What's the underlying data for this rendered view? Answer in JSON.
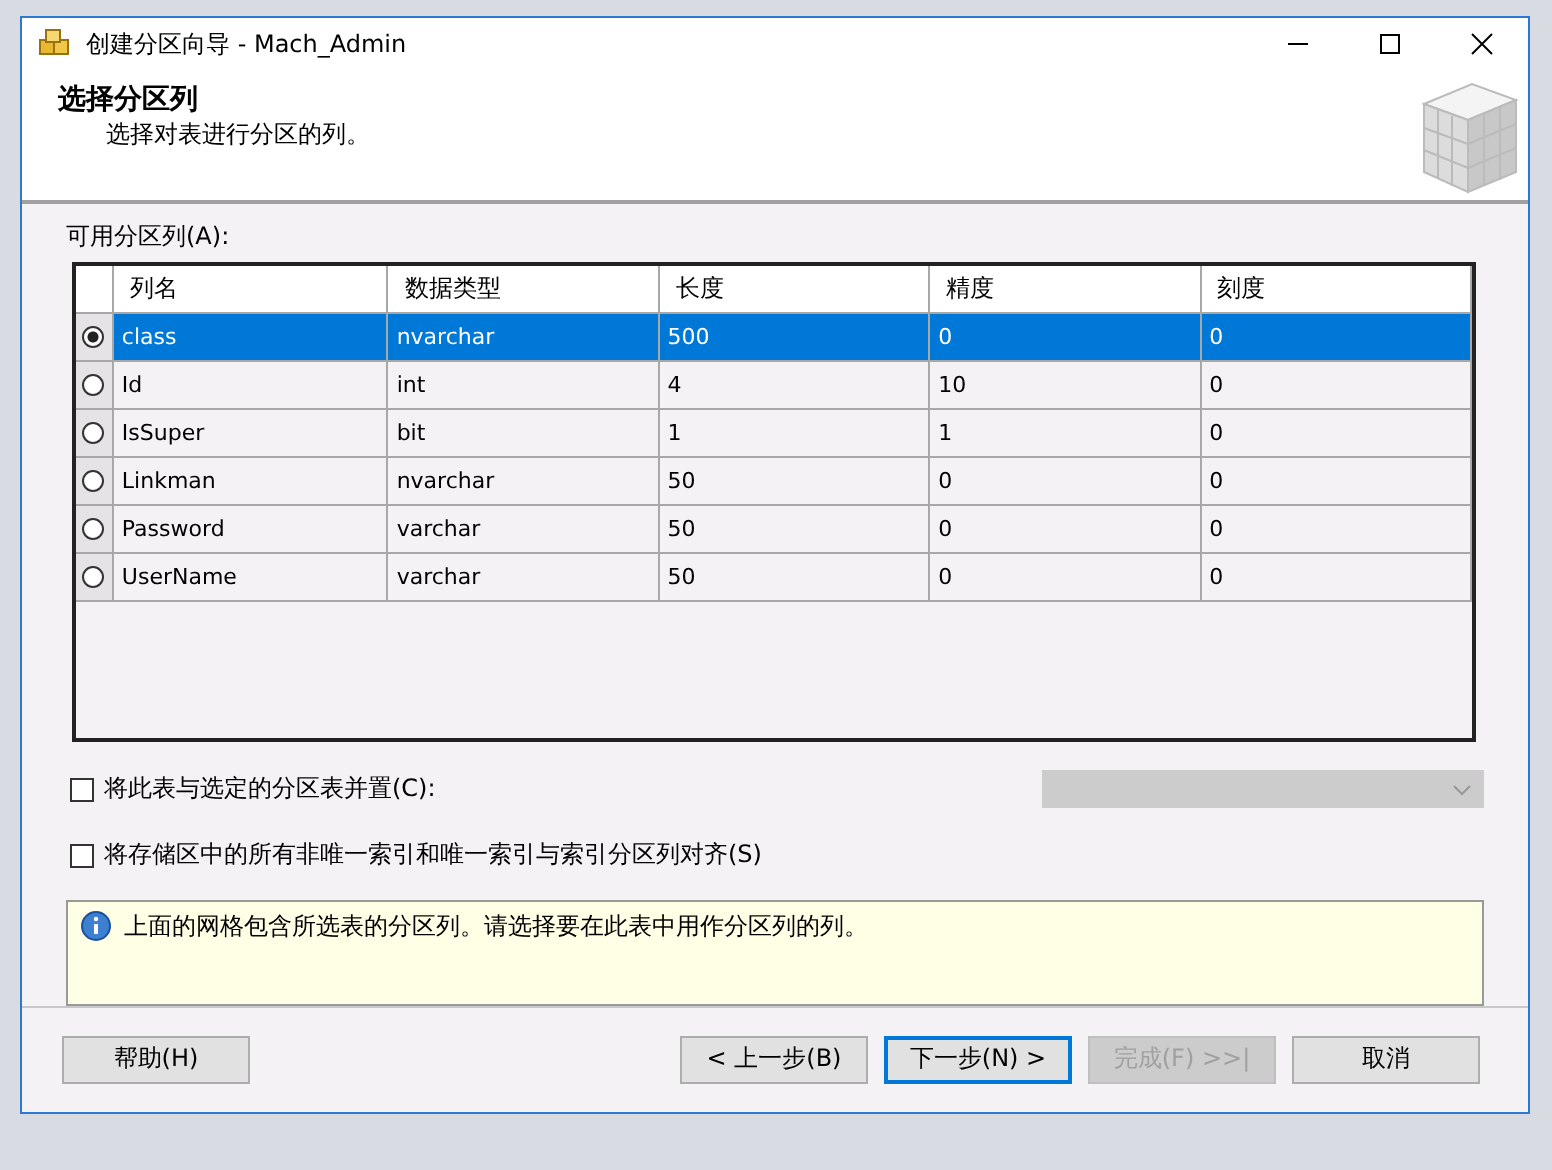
{
  "window": {
    "title": "创建分区向导 - Mach_Admin"
  },
  "header": {
    "title": "选择分区列",
    "subtitle": "选择对表进行分区的列。"
  },
  "grid": {
    "label": "可用分区列(A):",
    "columns": [
      "列名",
      "数据类型",
      "长度",
      "精度",
      "刻度"
    ],
    "rows": [
      {
        "selected": true,
        "cells": [
          "class",
          "nvarchar",
          "500",
          "0",
          "0"
        ]
      },
      {
        "selected": false,
        "cells": [
          "Id",
          "int",
          "4",
          "10",
          "0"
        ]
      },
      {
        "selected": false,
        "cells": [
          "IsSuper",
          "bit",
          "1",
          "1",
          "0"
        ]
      },
      {
        "selected": false,
        "cells": [
          "Linkman",
          "nvarchar",
          "50",
          "0",
          "0"
        ]
      },
      {
        "selected": false,
        "cells": [
          "Password",
          "varchar",
          "50",
          "0",
          "0"
        ]
      },
      {
        "selected": false,
        "cells": [
          "UserName",
          "varchar",
          "50",
          "0",
          "0"
        ]
      }
    ]
  },
  "options": [
    {
      "label": "将此表与选定的分区表并置(C):",
      "checked": false,
      "dropdown": {
        "disabled": true
      }
    },
    {
      "label": "将存储区中的所有非唯一索引和唯一索引与索引分区列对齐(S)",
      "checked": false
    }
  ],
  "info": "上面的网格包含所选表的分区列。请选择要在此表中用作分区列的列。",
  "buttons": [
    {
      "label": "帮助(H)",
      "disabled": false,
      "default": false
    },
    {
      "label": "< 上一步(B)",
      "disabled": false,
      "default": false
    },
    {
      "label": "下一步(N) >",
      "disabled": false,
      "default": true
    },
    {
      "label": "完成(F) >>|",
      "disabled": true,
      "default": false
    },
    {
      "label": "取消",
      "disabled": false,
      "default": false
    }
  ]
}
